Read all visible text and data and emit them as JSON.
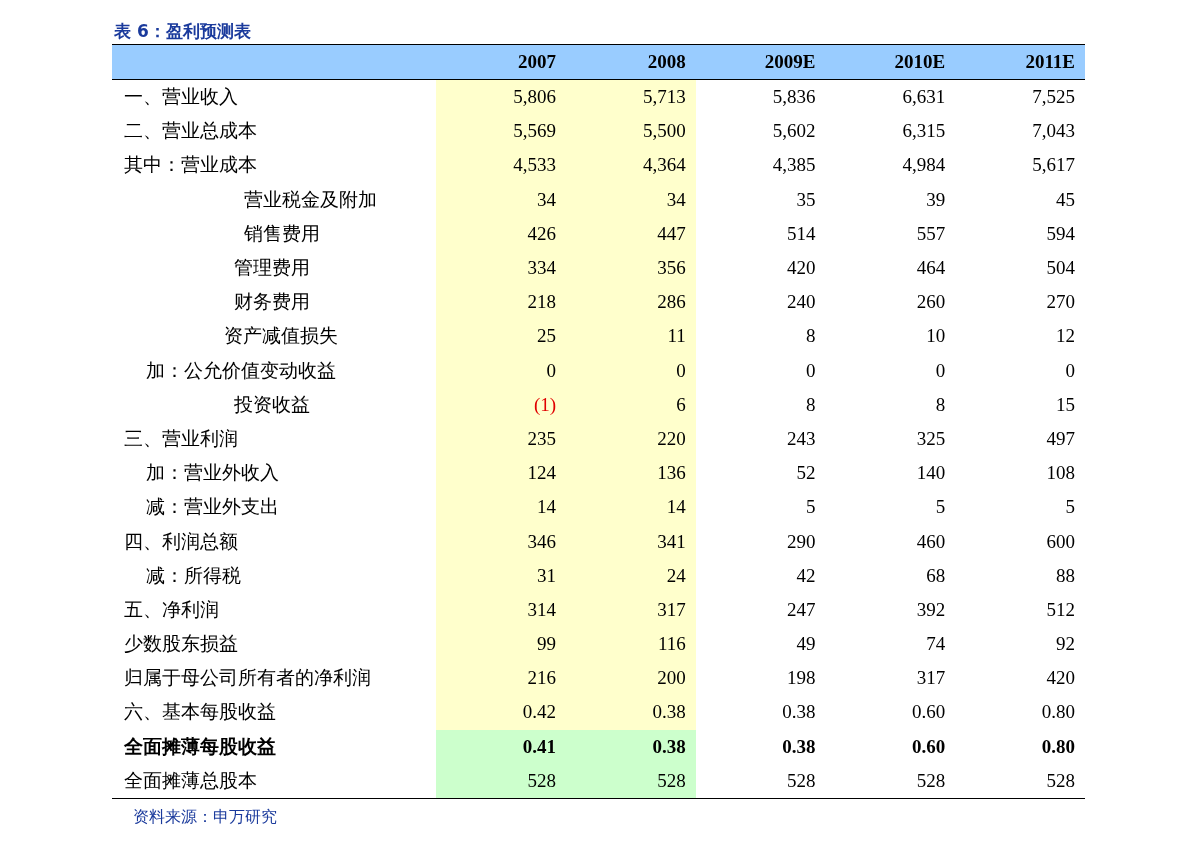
{
  "title": "表 6：盈利预测表",
  "table": {
    "columns": [
      {
        "label": "2007",
        "shaded": true
      },
      {
        "label": "2008",
        "shaded": true
      },
      {
        "label": "2009E",
        "shaded": false
      },
      {
        "label": "2010E",
        "shaded": false
      },
      {
        "label": "2011E",
        "shaded": false
      }
    ],
    "rows": [
      {
        "label": "一、营业收入",
        "kind": "item",
        "bold": false,
        "highlight": false,
        "values": [
          "5,806",
          "5,713",
          "5,836",
          "6,631",
          "7,525"
        ]
      },
      {
        "label": "二、营业总成本",
        "kind": "item",
        "bold": false,
        "highlight": false,
        "values": [
          "5,569",
          "5,500",
          "5,602",
          "6,315",
          "7,043"
        ]
      },
      {
        "label": "其中：营业成本",
        "kind": "item",
        "bold": false,
        "highlight": false,
        "values": [
          "4,533",
          "4,364",
          "4,385",
          "4,984",
          "5,617"
        ]
      },
      {
        "label": "营业税金及附加",
        "kind": "sub",
        "bold": false,
        "highlight": false,
        "values": [
          "34",
          "34",
          "35",
          "39",
          "45"
        ]
      },
      {
        "label": "销售费用",
        "kind": "sub",
        "bold": false,
        "highlight": false,
        "values": [
          "426",
          "447",
          "514",
          "557",
          "594"
        ]
      },
      {
        "label": "管理费用",
        "kind": "sub2",
        "bold": false,
        "highlight": false,
        "values": [
          "334",
          "356",
          "420",
          "464",
          "504"
        ]
      },
      {
        "label": "财务费用",
        "kind": "sub2",
        "bold": false,
        "highlight": false,
        "values": [
          "218",
          "286",
          "240",
          "260",
          "270"
        ]
      },
      {
        "label": "资产减值损失",
        "kind": "sub3",
        "bold": false,
        "highlight": false,
        "values": [
          "25",
          "11",
          "8",
          "10",
          "12"
        ]
      },
      {
        "label": "加：公允价值变动收益",
        "kind": "adj",
        "bold": false,
        "highlight": false,
        "values": [
          "0",
          "0",
          "0",
          "0",
          "0"
        ]
      },
      {
        "label": "投资收益",
        "kind": "sub2",
        "bold": false,
        "highlight": false,
        "negative": [
          true,
          false,
          false,
          false,
          false
        ],
        "values": [
          "(1)",
          "6",
          "8",
          "8",
          "15"
        ]
      },
      {
        "label": "三、营业利润",
        "kind": "item",
        "bold": false,
        "highlight": false,
        "values": [
          "235",
          "220",
          "243",
          "325",
          "497"
        ]
      },
      {
        "label": "加：营业外收入",
        "kind": "adj",
        "bold": false,
        "highlight": false,
        "values": [
          "124",
          "136",
          "52",
          "140",
          "108"
        ]
      },
      {
        "label": "减：营业外支出",
        "kind": "adj",
        "bold": false,
        "highlight": false,
        "values": [
          "14",
          "14",
          "5",
          "5",
          "5"
        ]
      },
      {
        "label": "四、利润总额",
        "kind": "item",
        "bold": false,
        "highlight": false,
        "values": [
          "346",
          "341",
          "290",
          "460",
          "600"
        ]
      },
      {
        "label": "减：所得税",
        "kind": "adj",
        "bold": false,
        "highlight": false,
        "values": [
          "31",
          "24",
          "42",
          "68",
          "88"
        ]
      },
      {
        "label": "五、净利润",
        "kind": "item",
        "bold": false,
        "highlight": false,
        "values": [
          "314",
          "317",
          "247",
          "392",
          "512"
        ]
      },
      {
        "label": "少数股东损益",
        "kind": "item",
        "bold": false,
        "highlight": false,
        "values": [
          "99",
          "116",
          "49",
          "74",
          "92"
        ]
      },
      {
        "label": "归属于母公司所有者的净利润",
        "kind": "item",
        "bold": false,
        "highlight": false,
        "values": [
          "216",
          "200",
          "198",
          "317",
          "420"
        ]
      },
      {
        "label": "六、基本每股收益",
        "kind": "item",
        "bold": false,
        "highlight": false,
        "values": [
          "0.42",
          "0.38",
          "0.38",
          "0.60",
          "0.80"
        ]
      },
      {
        "label": "全面摊薄每股收益",
        "kind": "item",
        "bold": true,
        "highlight": true,
        "values": [
          "0.41",
          "0.38",
          "0.38",
          "0.60",
          "0.80"
        ]
      },
      {
        "label": "全面摊薄总股本",
        "kind": "item",
        "bold": false,
        "highlight": true,
        "values": [
          "528",
          "528",
          "528",
          "528",
          "528"
        ]
      }
    ]
  },
  "source": "资料来源：申万研究"
}
